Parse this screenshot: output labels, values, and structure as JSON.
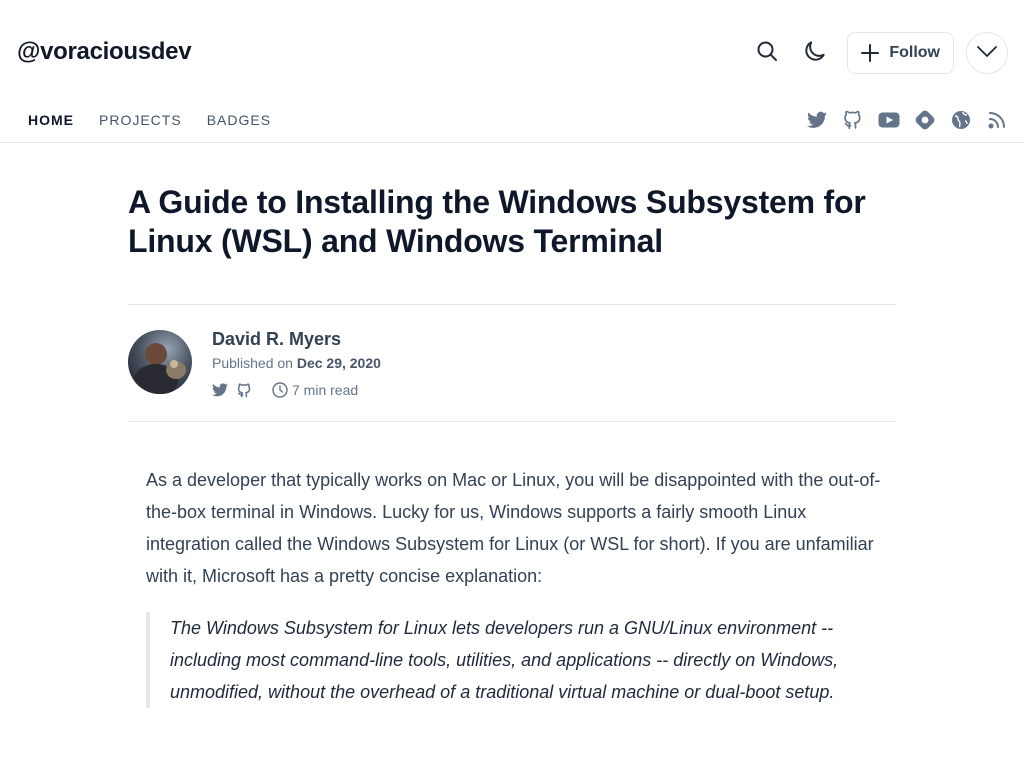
{
  "blog": {
    "handle": "@voraciousdev"
  },
  "header": {
    "follow_label": "Follow",
    "icons": [
      "search-icon",
      "moon-icon",
      "plus-icon",
      "chevron-down-icon"
    ]
  },
  "nav": {
    "items": [
      {
        "label": "HOME",
        "active": true
      },
      {
        "label": "PROJECTS",
        "active": false
      },
      {
        "label": "BADGES",
        "active": false
      }
    ],
    "social_icons": [
      "twitter-icon",
      "github-icon",
      "youtube-icon",
      "hashnode-icon",
      "globe-icon",
      "rss-icon"
    ]
  },
  "post": {
    "title": "A Guide to Installing the Windows Subsystem for Linux (WSL) and Windows Terminal",
    "author": {
      "name": "David R. Myers",
      "published_prefix": "Published on",
      "published_date": "Dec 29, 2020",
      "read_time": "7 min read",
      "icons": [
        "twitter-icon",
        "github-icon",
        "clock-icon"
      ]
    },
    "paragraph": "As a developer that typically works on Mac or Linux, you will be disappointed with the out-of-the-box terminal in Windows. Lucky for us, Windows supports a fairly smooth Linux integration called the Windows Subsystem for Linux (or WSL for short). If you are unfamiliar with it, Microsoft has a pretty concise explanation:",
    "quote": "The Windows Subsystem for Linux lets developers run a GNU/Linux environment -- including most command-line tools, utilities, and applications -- directly on Windows, unmodified, without the overhead of a traditional virtual machine or dual-boot setup."
  },
  "colors": {
    "text_dark": "#0f172a",
    "text_body": "#334155",
    "muted": "#64748b",
    "border": "#e5e7eb"
  }
}
